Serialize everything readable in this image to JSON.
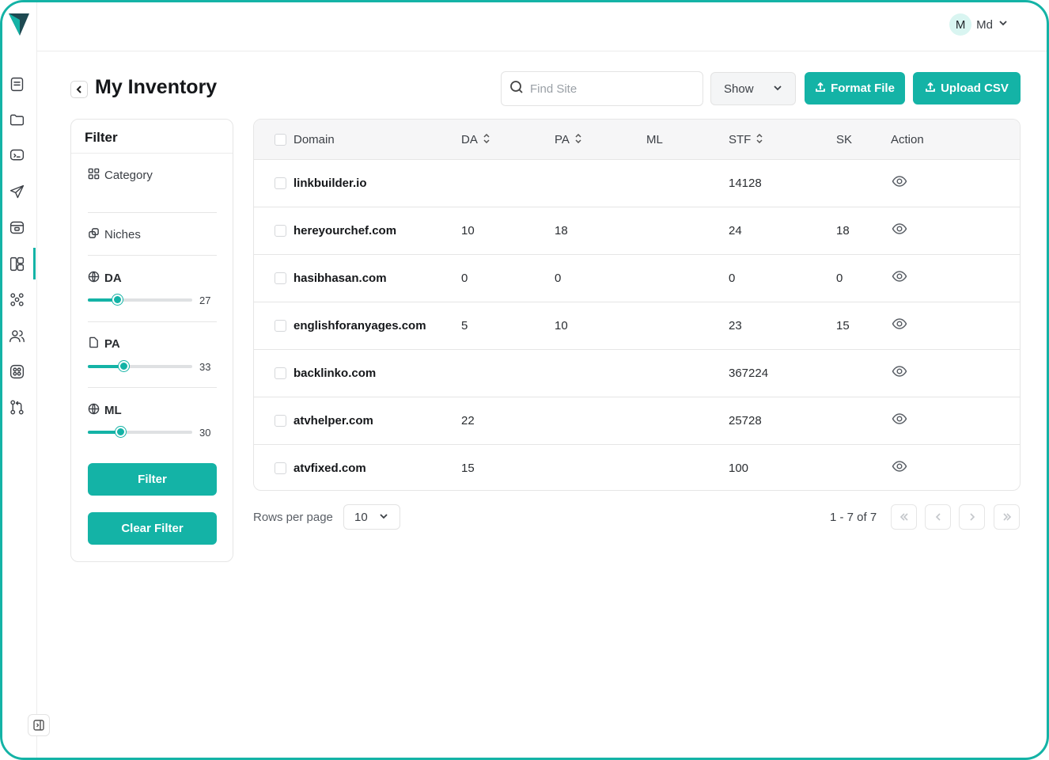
{
  "user": {
    "initial": "M",
    "name": "Md"
  },
  "page": {
    "title": "My Inventory"
  },
  "search": {
    "placeholder": "Find Site",
    "value": ""
  },
  "toolbar": {
    "show_label": "Show",
    "format_file_label": "Format File",
    "upload_csv_label": "Upload CSV"
  },
  "sidebar": {
    "icons": [
      "document-icon",
      "folder-icon",
      "message-icon",
      "send-icon",
      "archive-icon",
      "layout-icon",
      "network-icon",
      "users-icon",
      "palette-icon",
      "git-compare-icon"
    ],
    "active_index": 5
  },
  "filter": {
    "title": "Filter",
    "category_label": "Category",
    "niches_label": "Niches",
    "sliders": [
      {
        "label": "DA",
        "value": "27",
        "fraction": 0.28
      },
      {
        "label": "PA",
        "value": "33",
        "fraction": 0.34
      },
      {
        "label": "ML",
        "value": "30",
        "fraction": 0.31
      }
    ],
    "filter_button": "Filter",
    "clear_button": "Clear Filter"
  },
  "table": {
    "columns": [
      "Domain",
      "DA",
      "PA",
      "ML",
      "STF",
      "SK",
      "Action"
    ],
    "rows": [
      {
        "domain": "linkbuilder.io",
        "da": "",
        "pa": "",
        "ml": "",
        "stf": "14128",
        "sk": ""
      },
      {
        "domain": "hereyourchef.com",
        "da": "10",
        "pa": "18",
        "ml": "",
        "stf": "24",
        "sk": "18"
      },
      {
        "domain": "hasibhasan.com",
        "da": "0",
        "pa": "0",
        "ml": "",
        "stf": "0",
        "sk": "0"
      },
      {
        "domain": "englishforanyages.com",
        "da": "5",
        "pa": "10",
        "ml": "",
        "stf": "23",
        "sk": "15"
      },
      {
        "domain": "backlinko.com",
        "da": "",
        "pa": "",
        "ml": "",
        "stf": "367224",
        "sk": ""
      },
      {
        "domain": "atvhelper.com",
        "da": "22",
        "pa": "",
        "ml": "",
        "stf": "25728",
        "sk": ""
      },
      {
        "domain": "atvfixed.com",
        "da": "15",
        "pa": "",
        "ml": "",
        "stf": "100",
        "sk": ""
      }
    ]
  },
  "pagination": {
    "rows_per_page_label": "Rows per page",
    "rows_per_page_value": "10",
    "range_text": "1 - 7 of 7"
  },
  "colors": {
    "accent": "#14b3a6",
    "border": "#e6e6e6",
    "header_bg": "#f6f6f7"
  }
}
